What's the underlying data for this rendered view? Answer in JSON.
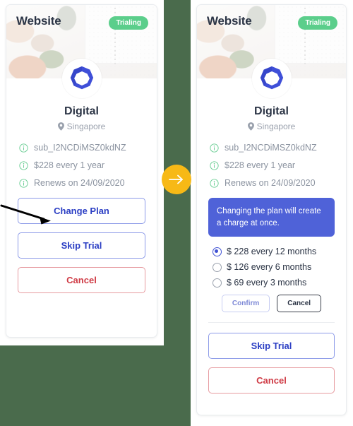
{
  "page": {
    "background_color": "#4a6b4c",
    "panels": [
      "before",
      "after"
    ]
  },
  "card": {
    "hero_title": "Website",
    "status_badge": "Trialing",
    "logo_icon": "octagon-ring-logo",
    "plan_name": "Digital",
    "location": "Singapore",
    "location_icon": "map-pin-icon",
    "info_icon": "info-circle-icon",
    "info_rows": [
      "sub_I2NCDiMSZ0kdNZ",
      "$228 every 1 year",
      "Renews on 24/09/2020"
    ]
  },
  "left_panel": {
    "buttons": [
      {
        "label": "Change Plan",
        "style": "blue"
      },
      {
        "label": "Skip Trial",
        "style": "blue"
      },
      {
        "label": "Cancel",
        "style": "red"
      }
    ],
    "annotation": {
      "icon": "pointer-arrow-icon",
      "target": "Change Plan"
    }
  },
  "right_panel": {
    "alert_text": "Changing the plan will create a charge at once.",
    "alert_color": "#4f62d8",
    "plan_options": [
      {
        "label": "$ 228 every 12 months",
        "selected": true
      },
      {
        "label": "$ 126 every 6 months",
        "selected": false
      },
      {
        "label": "$ 69 every 3 months",
        "selected": false
      }
    ],
    "confirm_label": "Confirm",
    "cancel_small_label": "Cancel",
    "buttons": [
      {
        "label": "Skip Trial",
        "style": "blue"
      },
      {
        "label": "Cancel",
        "style": "red"
      }
    ]
  },
  "connector": {
    "icon": "right-arrow-icon",
    "color": "#f7b916"
  },
  "colors": {
    "badge_green": "#5bce8b",
    "blue_accent": "#2c3fc4",
    "red_accent": "#cf3b45",
    "logo_blue": "#3f4fd8",
    "text_dark": "#2b3445",
    "text_muted": "#8b93a0"
  }
}
